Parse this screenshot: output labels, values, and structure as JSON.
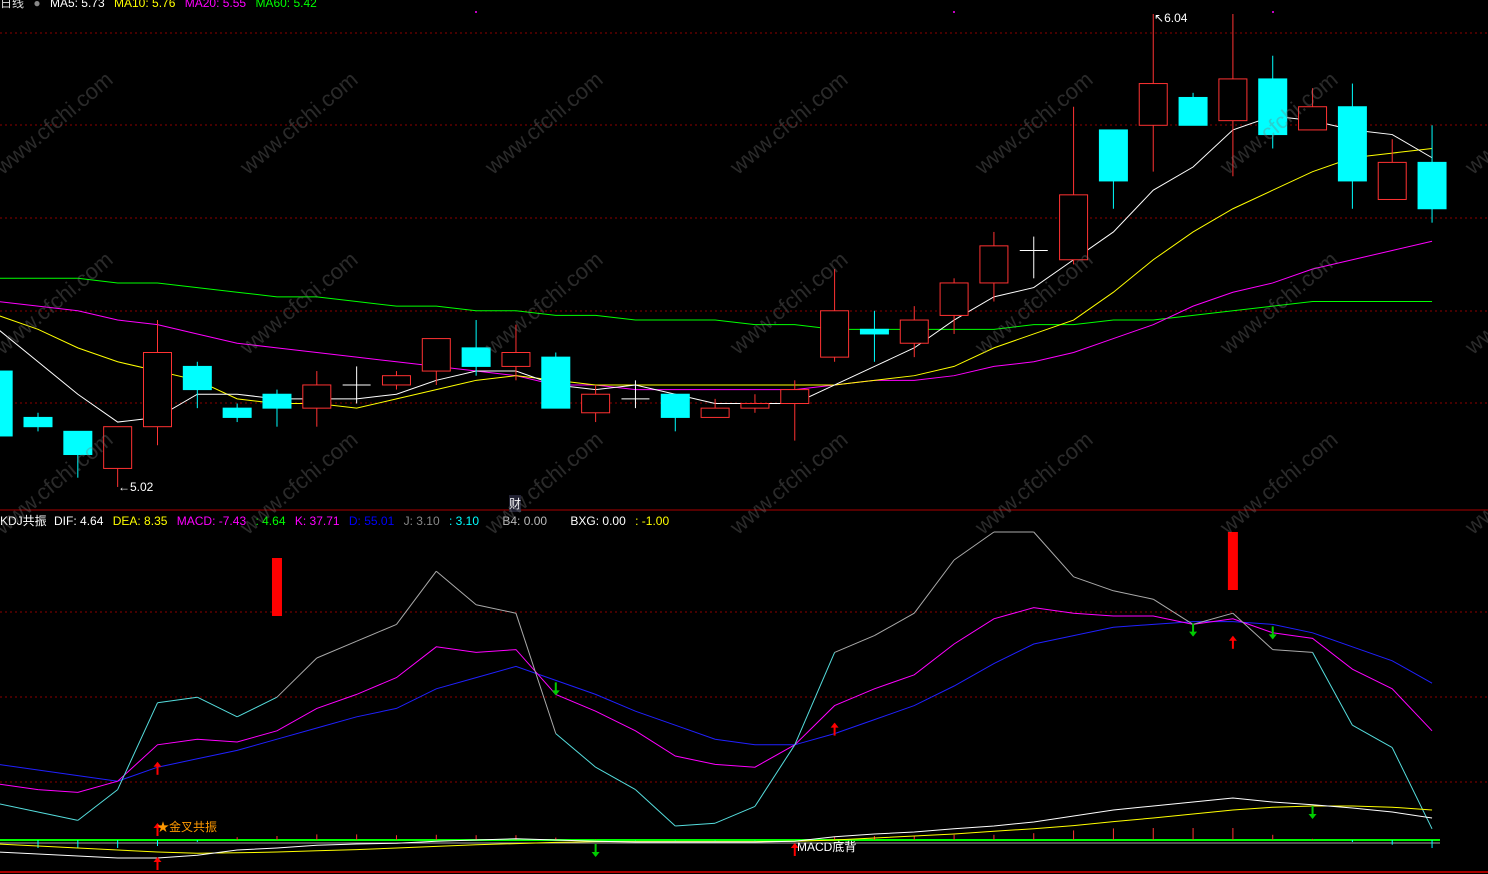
{
  "header": {
    "period": "日线",
    "ma5": "MA5: 5.73",
    "ma10": "MA10: 5.76",
    "ma20": "MA20: 5.55",
    "ma60": "MA60: 5.42"
  },
  "indicator_header": {
    "name": "KDJ共振",
    "dif": "DIF: 4.64",
    "dea": "DEA: 8.35",
    "macd": "MACD: -7.43",
    "v1": ": 4.64",
    "k": "K: 37.71",
    "d": "D: 55.01",
    "j": "J: 3.10",
    "v2": ": 3.10",
    "b4": "B4: 0.00",
    "bxg": "BXG: 0.00",
    "v3": ": -1.00"
  },
  "markers": {
    "high_label": "6.04",
    "low_label": "5.02",
    "finance_flag": "财",
    "golden_cross": "★金叉共振",
    "macd_divergence": "MACD底背"
  },
  "watermark": "www.cfchi.com",
  "colors": {
    "up": "#ff3232",
    "down": "#00ffff",
    "ma5": "#ffffff",
    "ma10": "#ffff00",
    "ma20": "#ff00ff",
    "ma60": "#00ff00",
    "k": "#ff00ff",
    "d": "#0000ff",
    "j_hi": "#aaaaaa",
    "j_lo": "#55dddd",
    "grid": "#8b0000"
  },
  "chart_data": [
    {
      "type": "candlestick",
      "title": "日线",
      "ylim": [
        5.02,
        6.04
      ],
      "candles": [
        {
          "o": 5.27,
          "c": 5.13,
          "h": 5.27,
          "l": 5.13
        },
        {
          "o": 5.17,
          "c": 5.15,
          "h": 5.18,
          "l": 5.14
        },
        {
          "o": 5.14,
          "c": 5.09,
          "h": 5.14,
          "l": 5.04
        },
        {
          "o": 5.06,
          "c": 5.15,
          "h": 5.15,
          "l": 5.02
        },
        {
          "o": 5.15,
          "c": 5.31,
          "h": 5.38,
          "l": 5.11
        },
        {
          "o": 5.28,
          "c": 5.23,
          "h": 5.29,
          "l": 5.19
        },
        {
          "o": 5.19,
          "c": 5.17,
          "h": 5.2,
          "l": 5.16
        },
        {
          "o": 5.22,
          "c": 5.19,
          "h": 5.23,
          "l": 5.15
        },
        {
          "o": 5.19,
          "c": 5.24,
          "h": 5.27,
          "l": 5.15
        },
        {
          "o": 5.24,
          "c": 5.24,
          "h": 5.28,
          "l": 5.2
        },
        {
          "o": 5.24,
          "c": 5.26,
          "h": 5.27,
          "l": 5.23
        },
        {
          "o": 5.27,
          "c": 5.34,
          "h": 5.34,
          "l": 5.24
        },
        {
          "o": 5.32,
          "c": 5.28,
          "h": 5.38,
          "l": 5.26
        },
        {
          "o": 5.28,
          "c": 5.31,
          "h": 5.37,
          "l": 5.25
        },
        {
          "o": 5.3,
          "c": 5.19,
          "h": 5.31,
          "l": 5.19
        },
        {
          "o": 5.18,
          "c": 5.22,
          "h": 5.24,
          "l": 5.16
        },
        {
          "o": 5.21,
          "c": 5.21,
          "h": 5.25,
          "l": 5.19
        },
        {
          "o": 5.22,
          "c": 5.17,
          "h": 5.22,
          "l": 5.14
        },
        {
          "o": 5.17,
          "c": 5.19,
          "h": 5.21,
          "l": 5.17
        },
        {
          "o": 5.19,
          "c": 5.2,
          "h": 5.22,
          "l": 5.18
        },
        {
          "o": 5.2,
          "c": 5.23,
          "h": 5.25,
          "l": 5.12
        },
        {
          "o": 5.3,
          "c": 5.4,
          "h": 5.49,
          "l": 5.29
        },
        {
          "o": 5.36,
          "c": 5.35,
          "h": 5.4,
          "l": 5.29
        },
        {
          "o": 5.33,
          "c": 5.38,
          "h": 5.41,
          "l": 5.3
        },
        {
          "o": 5.39,
          "c": 5.46,
          "h": 5.47,
          "l": 5.35
        },
        {
          "o": 5.46,
          "c": 5.54,
          "h": 5.57,
          "l": 5.42
        },
        {
          "o": 5.53,
          "c": 5.53,
          "h": 5.56,
          "l": 5.47
        },
        {
          "o": 5.51,
          "c": 5.65,
          "h": 5.84,
          "l": 5.5
        },
        {
          "o": 5.79,
          "c": 5.68,
          "h": 5.79,
          "l": 5.62
        },
        {
          "o": 5.8,
          "c": 5.89,
          "h": 6.04,
          "l": 5.7
        },
        {
          "o": 5.86,
          "c": 5.8,
          "h": 5.87,
          "l": 5.8
        },
        {
          "o": 5.81,
          "c": 5.9,
          "h": 6.04,
          "l": 5.69
        },
        {
          "o": 5.9,
          "c": 5.78,
          "h": 5.95,
          "l": 5.75
        },
        {
          "o": 5.79,
          "c": 5.84,
          "h": 5.88,
          "l": 5.79
        },
        {
          "o": 5.84,
          "c": 5.68,
          "h": 5.89,
          "l": 5.62
        },
        {
          "o": 5.64,
          "c": 5.72,
          "h": 5.77,
          "l": 5.64
        },
        {
          "o": 5.72,
          "c": 5.62,
          "h": 5.8,
          "l": 5.59
        }
      ],
      "ma5": [
        5.36,
        5.29,
        5.22,
        5.16,
        5.17,
        5.22,
        5.22,
        5.21,
        5.21,
        5.21,
        5.22,
        5.25,
        5.27,
        5.27,
        5.24,
        5.23,
        5.24,
        5.22,
        5.2,
        5.2,
        5.2,
        5.24,
        5.28,
        5.32,
        5.38,
        5.43,
        5.45,
        5.51,
        5.57,
        5.66,
        5.71,
        5.79,
        5.82,
        5.81,
        5.79,
        5.78,
        5.73
      ],
      "ma10": [
        5.39,
        5.36,
        5.32,
        5.29,
        5.27,
        5.25,
        5.21,
        5.2,
        5.2,
        5.19,
        5.21,
        5.23,
        5.25,
        5.26,
        5.25,
        5.24,
        5.24,
        5.24,
        5.24,
        5.24,
        5.24,
        5.24,
        5.25,
        5.26,
        5.28,
        5.32,
        5.35,
        5.38,
        5.44,
        5.51,
        5.57,
        5.62,
        5.66,
        5.7,
        5.73,
        5.74,
        5.75
      ],
      "ma20": [
        5.42,
        5.41,
        5.4,
        5.38,
        5.37,
        5.35,
        5.33,
        5.32,
        5.31,
        5.3,
        5.29,
        5.28,
        5.27,
        5.26,
        5.24,
        5.24,
        5.23,
        5.23,
        5.23,
        5.23,
        5.23,
        5.24,
        5.25,
        5.25,
        5.26,
        5.28,
        5.29,
        5.31,
        5.34,
        5.37,
        5.41,
        5.44,
        5.46,
        5.49,
        5.51,
        5.53,
        5.55
      ],
      "ma60": [
        5.47,
        5.47,
        5.47,
        5.46,
        5.46,
        5.45,
        5.44,
        5.43,
        5.43,
        5.42,
        5.41,
        5.41,
        5.4,
        5.4,
        5.39,
        5.39,
        5.38,
        5.38,
        5.38,
        5.37,
        5.37,
        5.36,
        5.36,
        5.36,
        5.36,
        5.36,
        5.37,
        5.37,
        5.38,
        5.38,
        5.39,
        5.4,
        5.41,
        5.42,
        5.42,
        5.42,
        5.42
      ]
    },
    {
      "type": "line",
      "title": "KDJ共振",
      "k": [
        20,
        18,
        17,
        21,
        34,
        36,
        35,
        39,
        47,
        52,
        58,
        69,
        67,
        68,
        52,
        46,
        39,
        30,
        27,
        26,
        34,
        48,
        54,
        59,
        70,
        79,
        83,
        81,
        80,
        80,
        77,
        79,
        74,
        72,
        61,
        54,
        39
      ],
      "d": [
        27,
        25,
        23,
        21,
        26,
        29,
        32,
        36,
        40,
        44,
        47,
        54,
        58,
        62,
        57,
        52,
        46,
        41,
        36,
        34,
        34,
        38,
        43,
        48,
        55,
        63,
        70,
        73,
        76,
        77,
        78,
        78,
        77,
        74,
        69,
        64,
        56
      ],
      "j": [
        13,
        10,
        7,
        18,
        49,
        51,
        44,
        51,
        65,
        71,
        77,
        96,
        84,
        81,
        38,
        26,
        18,
        5,
        6,
        12,
        34,
        67,
        73,
        81,
        100,
        110,
        110,
        94,
        89,
        86,
        77,
        81,
        68,
        67,
        41,
        33,
        4
      ],
      "dif": [
        -3,
        -3.5,
        -4,
        -4.5,
        -4.5,
        -3.8,
        -2.5,
        -2,
        -1.3,
        -1,
        -0.8,
        -0.3,
        0,
        0.3,
        0,
        -0.3,
        -0.5,
        -0.5,
        -0.5,
        -0.5,
        -0.3,
        0.8,
        1.5,
        2,
        2.8,
        3.5,
        4.5,
        6,
        7.5,
        8.5,
        9.5,
        10.5,
        9.5,
        8.8,
        8,
        7,
        5.5
      ],
      "dea": [
        -1,
        -1.5,
        -2,
        -2.5,
        -3,
        -3.3,
        -3.2,
        -3,
        -2.7,
        -2.4,
        -2,
        -1.6,
        -1.2,
        -0.9,
        -0.6,
        -0.4,
        -0.4,
        -0.4,
        -0.4,
        -0.4,
        -0.3,
        0,
        0.5,
        1,
        1.5,
        2.2,
        2.8,
        3.6,
        4.6,
        5.5,
        6.5,
        7.5,
        8.2,
        8.5,
        8.5,
        8.2,
        7.5
      ],
      "signal_bars": [
        7,
        31
      ],
      "buy_arrows_kdj": [
        4,
        21,
        31
      ],
      "sell_arrows_kdj": [
        14,
        30,
        32
      ],
      "buy_arrows_macd": [
        4,
        20
      ],
      "sell_arrows_macd": [
        15,
        33
      ]
    }
  ]
}
